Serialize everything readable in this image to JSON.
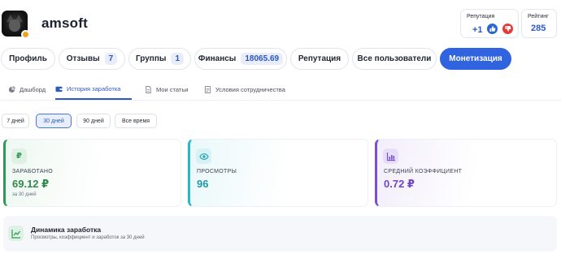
{
  "profile": {
    "username": "amsoft"
  },
  "reputation": {
    "label": "Репутация",
    "value": "+1"
  },
  "rating": {
    "label": "Рейтинг",
    "value": "285"
  },
  "tabs": [
    {
      "label": "Профиль"
    },
    {
      "label": "Отзывы",
      "count": "7"
    },
    {
      "label": "Группы",
      "count": "1"
    },
    {
      "label": "Финансы",
      "count": "18065.69"
    },
    {
      "label": "Репутация"
    },
    {
      "label": "Все пользователи"
    },
    {
      "label": "Монетизация"
    }
  ],
  "subtabs": [
    {
      "label": "Дашборд"
    },
    {
      "label": "История заработка"
    },
    {
      "label": "Мои статьи"
    },
    {
      "label": "Условия сотрудничества"
    }
  ],
  "periods": [
    "7 дней",
    "30 дней",
    "90 дней",
    "Все время"
  ],
  "cards": [
    {
      "icon": "₽",
      "title": "ЗАРАБОТАНО",
      "value": "69.12 ₽",
      "sub": "за 30 дней"
    },
    {
      "icon": "eye",
      "title": "ПРОСМОТРЫ",
      "value": "96"
    },
    {
      "icon": "bar-chart",
      "title": "СРЕДНИЙ КОЭФФИЦИЕНТ",
      "value": "0.72 ₽"
    }
  ],
  "dynamics": {
    "title": "Динамика заработка",
    "subtitle": "Просмотры, коэффициент и заработок за 30 дней"
  },
  "colors": {
    "accent": "#2f63e0",
    "earned": "#2f8a4d",
    "views": "#1e9aab",
    "coef": "#7046c8",
    "vote_up": "#2d63d8",
    "vote_down": "#e03c3c",
    "status_dot": "#f0a224"
  }
}
